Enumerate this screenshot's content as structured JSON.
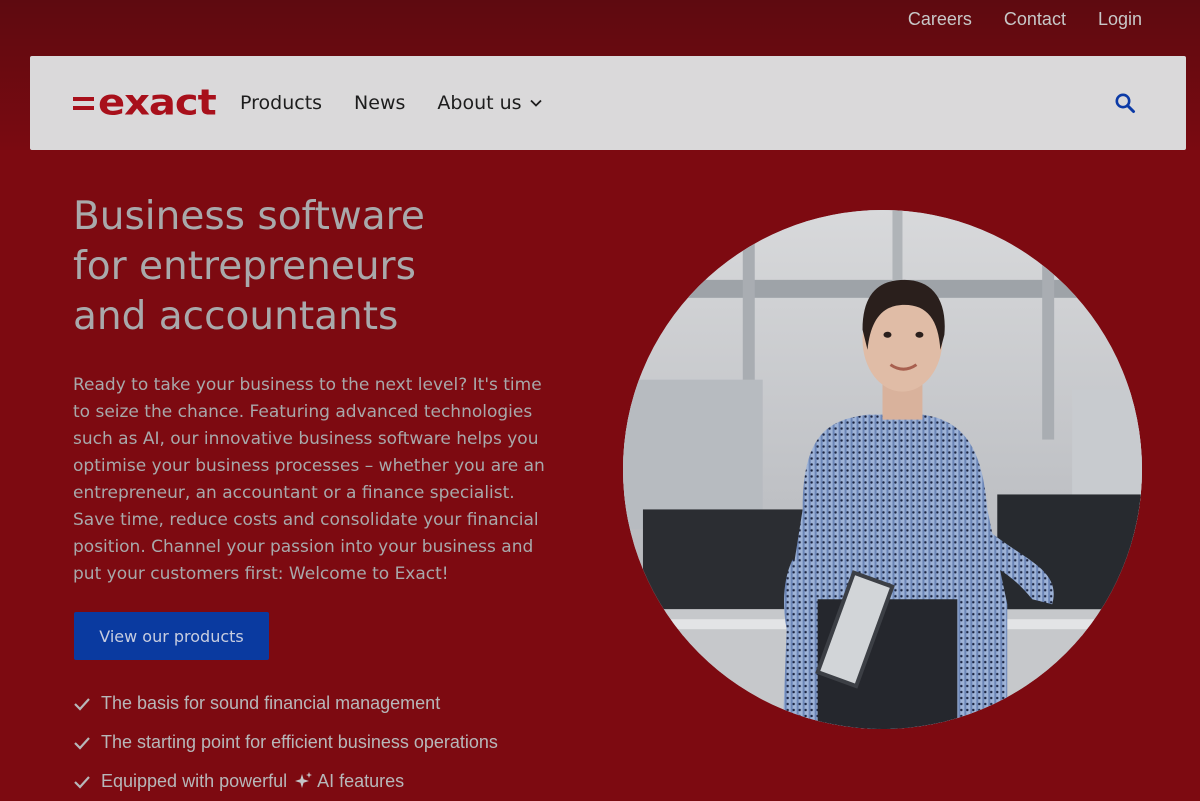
{
  "topbar": {
    "links": [
      "Careers",
      "Contact",
      "Login"
    ]
  },
  "brand": {
    "name": "exact",
    "color": "#a8101b"
  },
  "nav": {
    "items": [
      {
        "label": "Products"
      },
      {
        "label": "News"
      },
      {
        "label": "About us"
      }
    ],
    "search_icon": "search-icon"
  },
  "hero": {
    "title_lines": [
      "Business software",
      "for entrepreneurs",
      "and accountants"
    ],
    "body": "Ready to take your business to the next level? It's time to seize the chance. Featuring advanced technologies such as AI, our innovative business software helps you optimise your business processes – whether you are an entrepreneur, an accountant or a finance specialist. Save time, reduce costs and consolidate your financial position. Channel your passion into your business and put your customers first: Welcome to Exact!",
    "cta_label": "View our products",
    "benefits": [
      {
        "text": "The basis for sound financial management"
      },
      {
        "text": "The starting point for efficient business operations"
      },
      {
        "prefix": "Equipped with powerful",
        "suffix": "AI features",
        "icon": "sparkle-icon"
      }
    ]
  },
  "colors": {
    "overlay_red": "#7d0a11",
    "primary_button": "#0a3aa0"
  }
}
